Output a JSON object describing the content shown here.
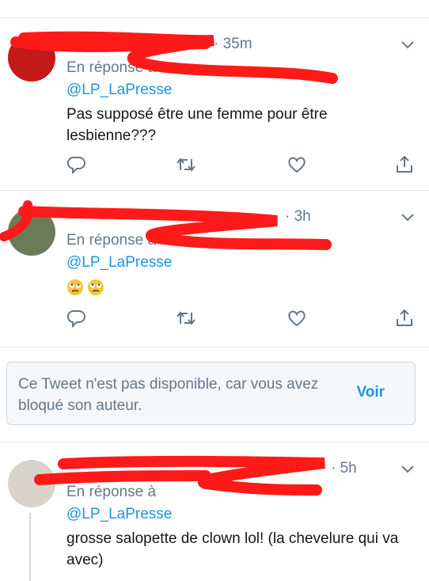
{
  "tweets": [
    {
      "time": "· 35m",
      "reply_prefix": "En réponse à",
      "mention": "@LP_LaPresse",
      "text": "Pas supposé être une femme pour être lesbienne???"
    },
    {
      "time": "· 3h",
      "reply_prefix": "En réponse à",
      "mention": "@LP_LaPresse",
      "text": "🙄🙄"
    },
    {
      "time": "· 5h",
      "reply_prefix": "En réponse à",
      "mention": "@LP_LaPresse",
      "text": "grosse salopette de clown lol! (la chevelure qui va avec)"
    }
  ],
  "notice": {
    "message": "Ce Tweet n'est pas disponible, car vous avez bloqué son auteur.",
    "action": "Voir"
  },
  "icons": [
    "reply-icon",
    "retweet-icon",
    "like-icon",
    "share-icon",
    "chevron-down-icon"
  ],
  "colors": {
    "link": "#1b95e0",
    "muted": "#657786",
    "redaction": "#ff1a1a"
  }
}
